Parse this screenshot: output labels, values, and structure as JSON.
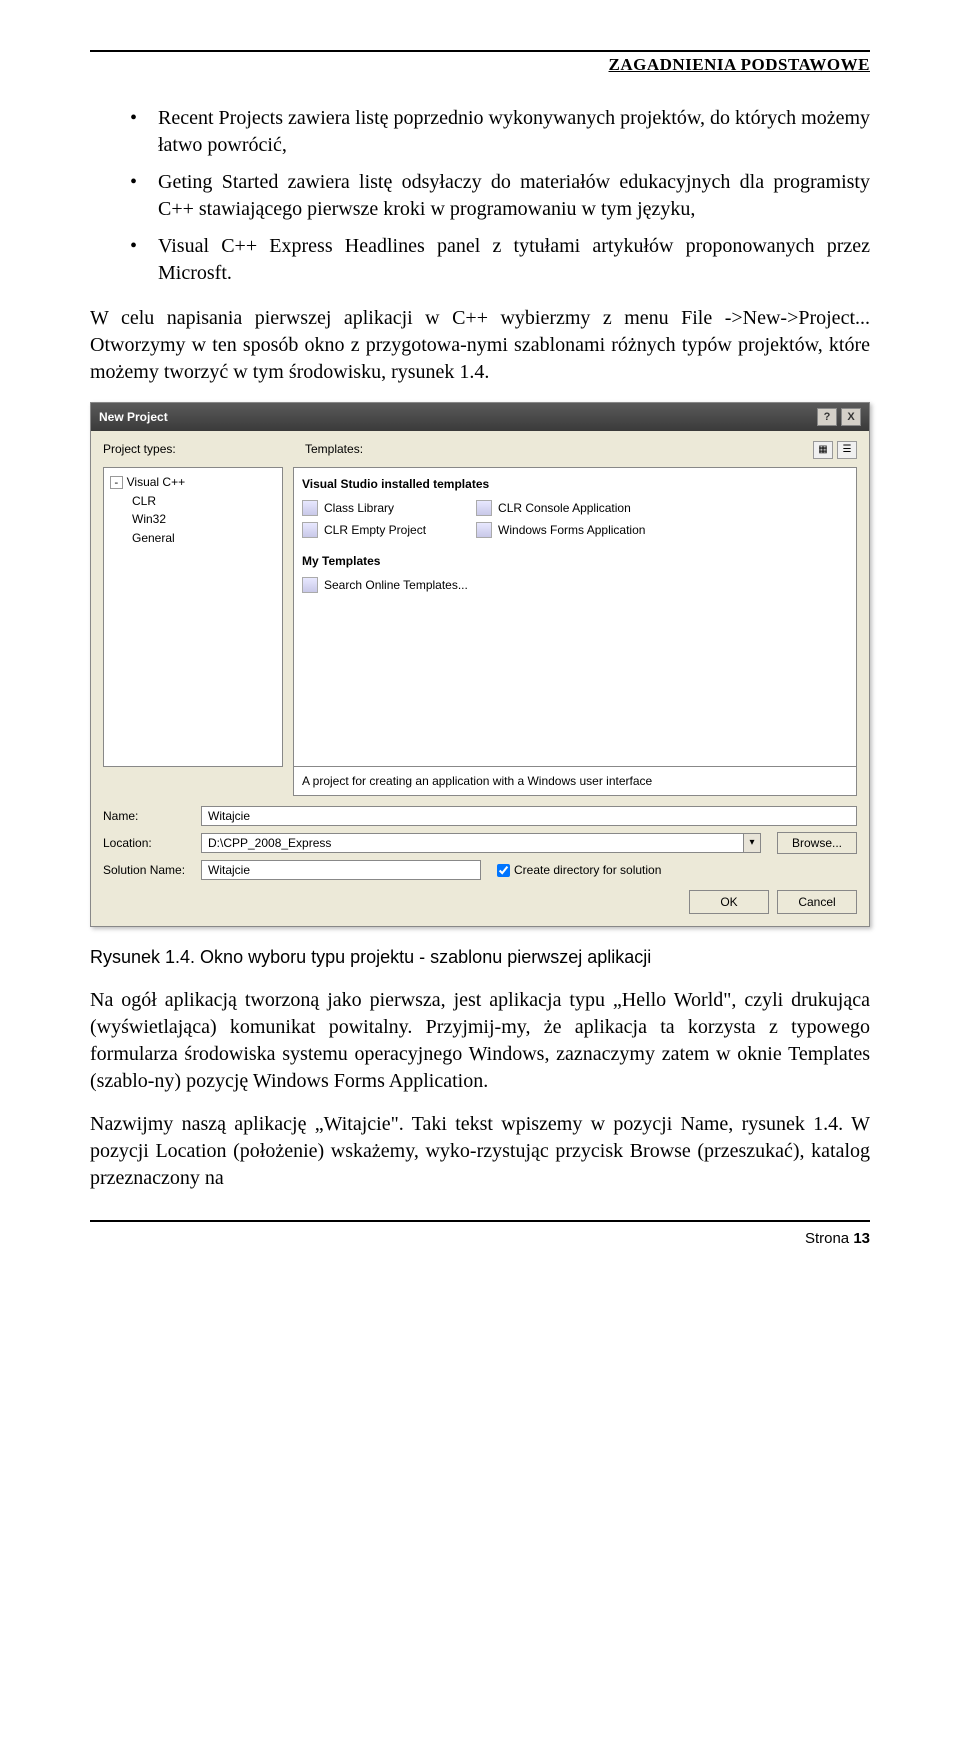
{
  "header": {
    "title": "ZAGADNIENIA PODSTAWOWE"
  },
  "bullets": [
    "Recent Projects zawiera listę poprzednio wykonywanych projektów, do których możemy łatwo powrócić,",
    "Geting Started zawiera listę odsyłaczy do materiałów edukacyjnych dla programisty C++ stawiającego pierwsze kroki w programowaniu w tym języku,",
    "Visual C++ Express Headlines panel z tytułami artykułów proponowanych przez Microsft."
  ],
  "para1": "W celu napisania pierwszej aplikacji w C++ wybierzmy z menu File ->New->Project... Otworzymy w ten sposób okno z przygotowa-nymi szablonami różnych typów projektów, które możemy tworzyć w tym środowisku, rysunek 1.4.",
  "dialog": {
    "title": "New Project",
    "help_icon": "?",
    "close_icon": "X",
    "project_types_label": "Project types:",
    "templates_label": "Templates:",
    "tree": {
      "root": "Visual C++",
      "children": [
        "CLR",
        "Win32",
        "General"
      ]
    },
    "templates_heading": "Visual Studio installed templates",
    "templates_col1": [
      "Class Library",
      "CLR Empty Project"
    ],
    "templates_col2": [
      "CLR Console Application",
      "Windows Forms Application"
    ],
    "my_templates_heading": "My Templates",
    "search_online": "Search Online Templates...",
    "description": "A project for creating an application with a Windows user interface",
    "name_label": "Name:",
    "name_value": "Witajcie",
    "location_label": "Location:",
    "location_value": "D:\\CPP_2008_Express",
    "browse": "Browse...",
    "solution_label": "Solution Name:",
    "solution_value": "Witajcie",
    "checkbox_label": "Create directory for solution",
    "ok": "OK",
    "cancel": "Cancel"
  },
  "caption": "Rysunek 1.4. Okno wyboru typu projektu - szablonu pierwszej aplikacji",
  "para2": "Na ogół aplikacją tworzoną jako pierwsza, jest aplikacja typu „Hello World\", czyli drukująca (wyświetlająca) komunikat powitalny. Przyjmij-my, że aplikacja ta korzysta z typowego formularza środowiska systemu operacyjnego Windows, zaznaczymy zatem w oknie Templates (szablo-ny) pozycję Windows Forms Application.",
  "para3": "Nazwijmy naszą aplikację „Witajcie\". Taki tekst wpiszemy w pozycji Name, rysunek 1.4. W pozycji Location (położenie) wskażemy, wyko-rzystując przycisk Browse (przeszukać), katalog przeznaczony na",
  "footer": {
    "label": "Strona ",
    "num": "13"
  }
}
